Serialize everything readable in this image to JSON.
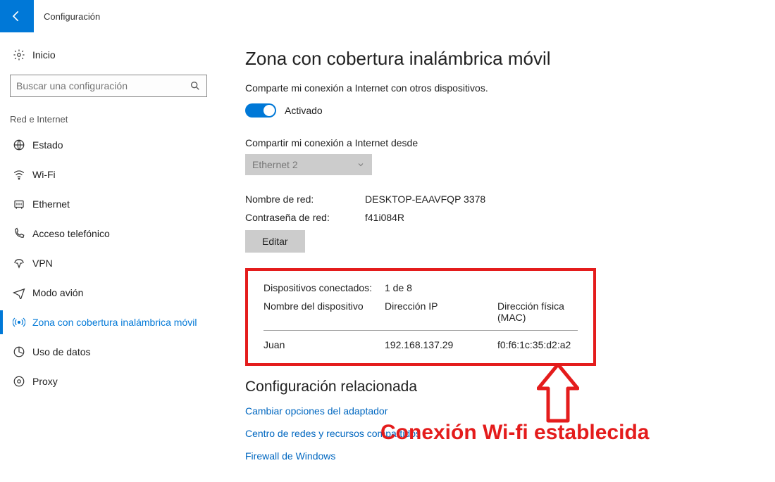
{
  "header": {
    "title": "Configuración"
  },
  "sidebar": {
    "home": "Inicio",
    "search_placeholder": "Buscar una configuración",
    "section": "Red e Internet",
    "items": [
      {
        "label": "Estado"
      },
      {
        "label": "Wi-Fi"
      },
      {
        "label": "Ethernet"
      },
      {
        "label": "Acceso telefónico"
      },
      {
        "label": "VPN"
      },
      {
        "label": "Modo avión"
      },
      {
        "label": "Zona con cobertura inalámbrica móvil"
      },
      {
        "label": "Uso de datos"
      },
      {
        "label": "Proxy"
      }
    ]
  },
  "main": {
    "title": "Zona con cobertura inalámbrica móvil",
    "share_text": "Comparte mi conexión a Internet con otros dispositivos.",
    "toggle_label": "Activado",
    "share_from_label": "Compartir mi conexión a Internet desde",
    "share_from_value": "Ethernet 2",
    "network_name_label": "Nombre de red:",
    "network_name_value": "DESKTOP-EAAVFQP 3378",
    "network_password_label": "Contraseña de red:",
    "network_password_value": "f41i084R",
    "edit_label": "Editar",
    "devices": {
      "label": "Dispositivos conectados:",
      "count": "1 de 8",
      "col1": "Nombre del dispositivo",
      "col2": "Dirección IP",
      "col3": "Dirección física (MAC)",
      "rows": [
        {
          "name": "Juan",
          "ip": "192.168.137.29",
          "mac": "f0:f6:1c:35:d2:a2"
        }
      ]
    },
    "related_title": "Configuración relacionada",
    "links": [
      "Cambiar opciones del adaptador",
      "Centro de redes y recursos compartidos",
      "Firewall de Windows"
    ]
  },
  "annotation": {
    "text": "Conexión Wi-fi establecida",
    "color": "#e41c1c"
  }
}
